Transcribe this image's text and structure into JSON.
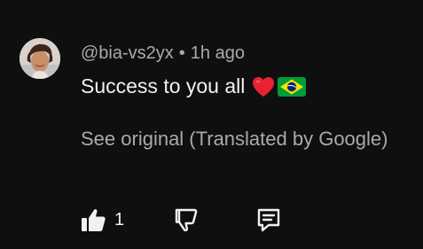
{
  "comment": {
    "author": "@bia-vs2yx",
    "separator": "•",
    "time": "1h ago",
    "text": "Success to you all",
    "emojis": [
      "red-heart",
      "brazil-flag"
    ],
    "translation_link": "See original (Translated by Google)"
  },
  "actions": {
    "like_count": "1"
  },
  "colors": {
    "background": "#0f0f0f",
    "primary_text": "#f1f1f1",
    "secondary_text": "#aaaaaa",
    "heart": "#e8232f",
    "flag_green": "#009b3a",
    "flag_yellow": "#fedf00",
    "flag_blue": "#002776"
  }
}
